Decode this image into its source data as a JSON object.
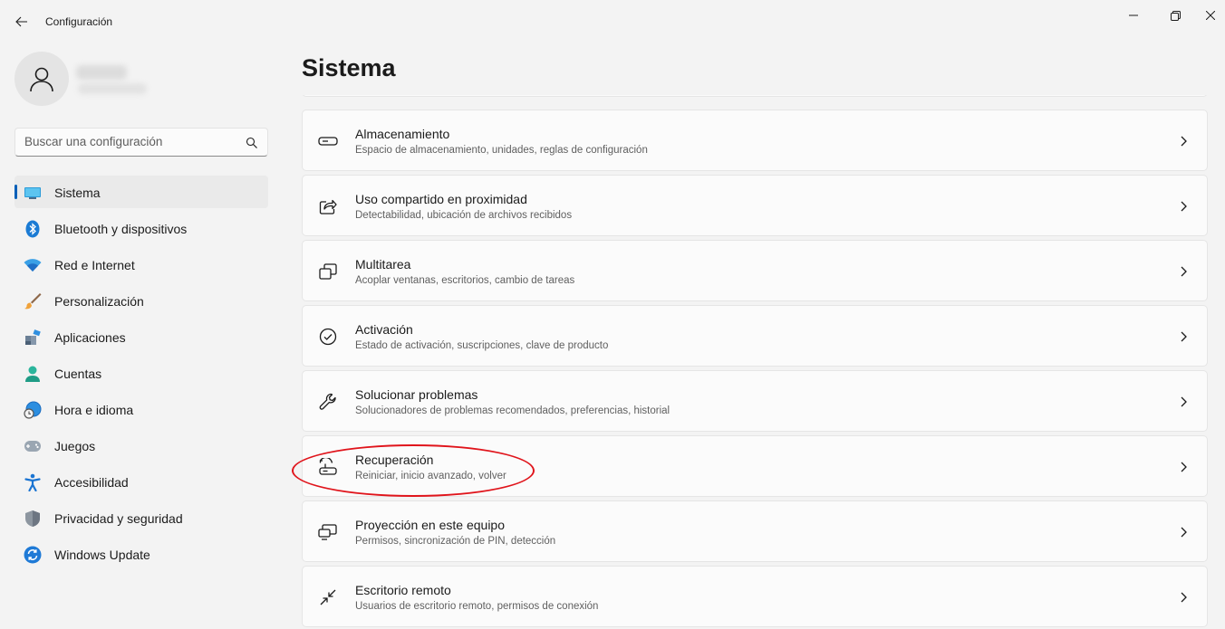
{
  "window": {
    "title": "Configuración"
  },
  "search": {
    "placeholder": "Buscar una configuración"
  },
  "sidebar": {
    "items": [
      {
        "label": "Sistema",
        "icon": "system-monitor-icon",
        "selected": true
      },
      {
        "label": "Bluetooth y dispositivos",
        "icon": "bluetooth-icon"
      },
      {
        "label": "Red e Internet",
        "icon": "wifi-icon"
      },
      {
        "label": "Personalización",
        "icon": "paintbrush-icon"
      },
      {
        "label": "Aplicaciones",
        "icon": "apps-icon"
      },
      {
        "label": "Cuentas",
        "icon": "account-icon"
      },
      {
        "label": "Hora e idioma",
        "icon": "globe-clock-icon"
      },
      {
        "label": "Juegos",
        "icon": "gamepad-icon"
      },
      {
        "label": "Accesibilidad",
        "icon": "accessibility-icon"
      },
      {
        "label": "Privacidad y seguridad",
        "icon": "shield-icon"
      },
      {
        "label": "Windows Update",
        "icon": "update-icon"
      }
    ]
  },
  "main": {
    "title": "Sistema",
    "cards": [
      {
        "title": "Almacenamiento",
        "subtitle": "Espacio de almacenamiento, unidades, reglas de configuración",
        "icon": "storage-drive-icon"
      },
      {
        "title": "Uso compartido en proximidad",
        "subtitle": "Detectabilidad, ubicación de archivos recibidos",
        "icon": "share-icon"
      },
      {
        "title": "Multitarea",
        "subtitle": "Acoplar ventanas, escritorios, cambio de tareas",
        "icon": "multitask-icon"
      },
      {
        "title": "Activación",
        "subtitle": "Estado de activación, suscripciones, clave de producto",
        "icon": "check-circle-icon"
      },
      {
        "title": "Solucionar problemas",
        "subtitle": "Solucionadores de problemas recomendados, preferencias, historial",
        "icon": "wrench-icon"
      },
      {
        "title": "Recuperación",
        "subtitle": "Reiniciar, inicio avanzado, volver",
        "icon": "recovery-icon",
        "highlighted": true
      },
      {
        "title": "Proyección en este equipo",
        "subtitle": "Permisos, sincronización de PIN, detección",
        "icon": "projection-icon"
      },
      {
        "title": "Escritorio remoto",
        "subtitle": "Usuarios de escritorio remoto, permisos de conexión",
        "icon": "remote-desktop-icon"
      }
    ]
  },
  "colors": {
    "accent": "#005fb8",
    "highlight_ellipse": "#e0141b",
    "background": "#f3f3f3",
    "card": "#fbfbfb"
  }
}
